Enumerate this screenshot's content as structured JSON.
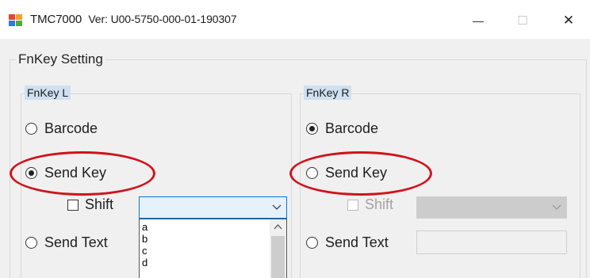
{
  "window": {
    "title": "TMC7000",
    "version": "Ver: U00-5750-000-01-190307",
    "buttons": {
      "minimize": "—",
      "maximize": "☐",
      "close": "✕"
    }
  },
  "main_group": {
    "title": "FnKey Setting"
  },
  "left": {
    "title": "FnKey L",
    "options": {
      "barcode": "Barcode",
      "send_key": "Send Key",
      "send_text": "Send Text"
    },
    "selected": "send_key",
    "shift_label": "Shift",
    "combo_value": "",
    "dropdown_items": [
      "a",
      "b",
      "c",
      "d"
    ]
  },
  "right": {
    "title": "FnKey R",
    "options": {
      "barcode": "Barcode",
      "send_key": "Send Key",
      "send_text": "Send Text"
    },
    "selected": "barcode",
    "shift_label": "Shift",
    "combo_value": "",
    "text_value": ""
  },
  "colors": {
    "highlight_ellipse": "#d0121b",
    "combo_active_border": "#0078d7",
    "group_label_bg": "#cfe0f1"
  },
  "icons": {
    "app": "app-grid-icon",
    "dropdown": "chevron-down-icon",
    "scroll_up": "chevron-up-icon"
  }
}
